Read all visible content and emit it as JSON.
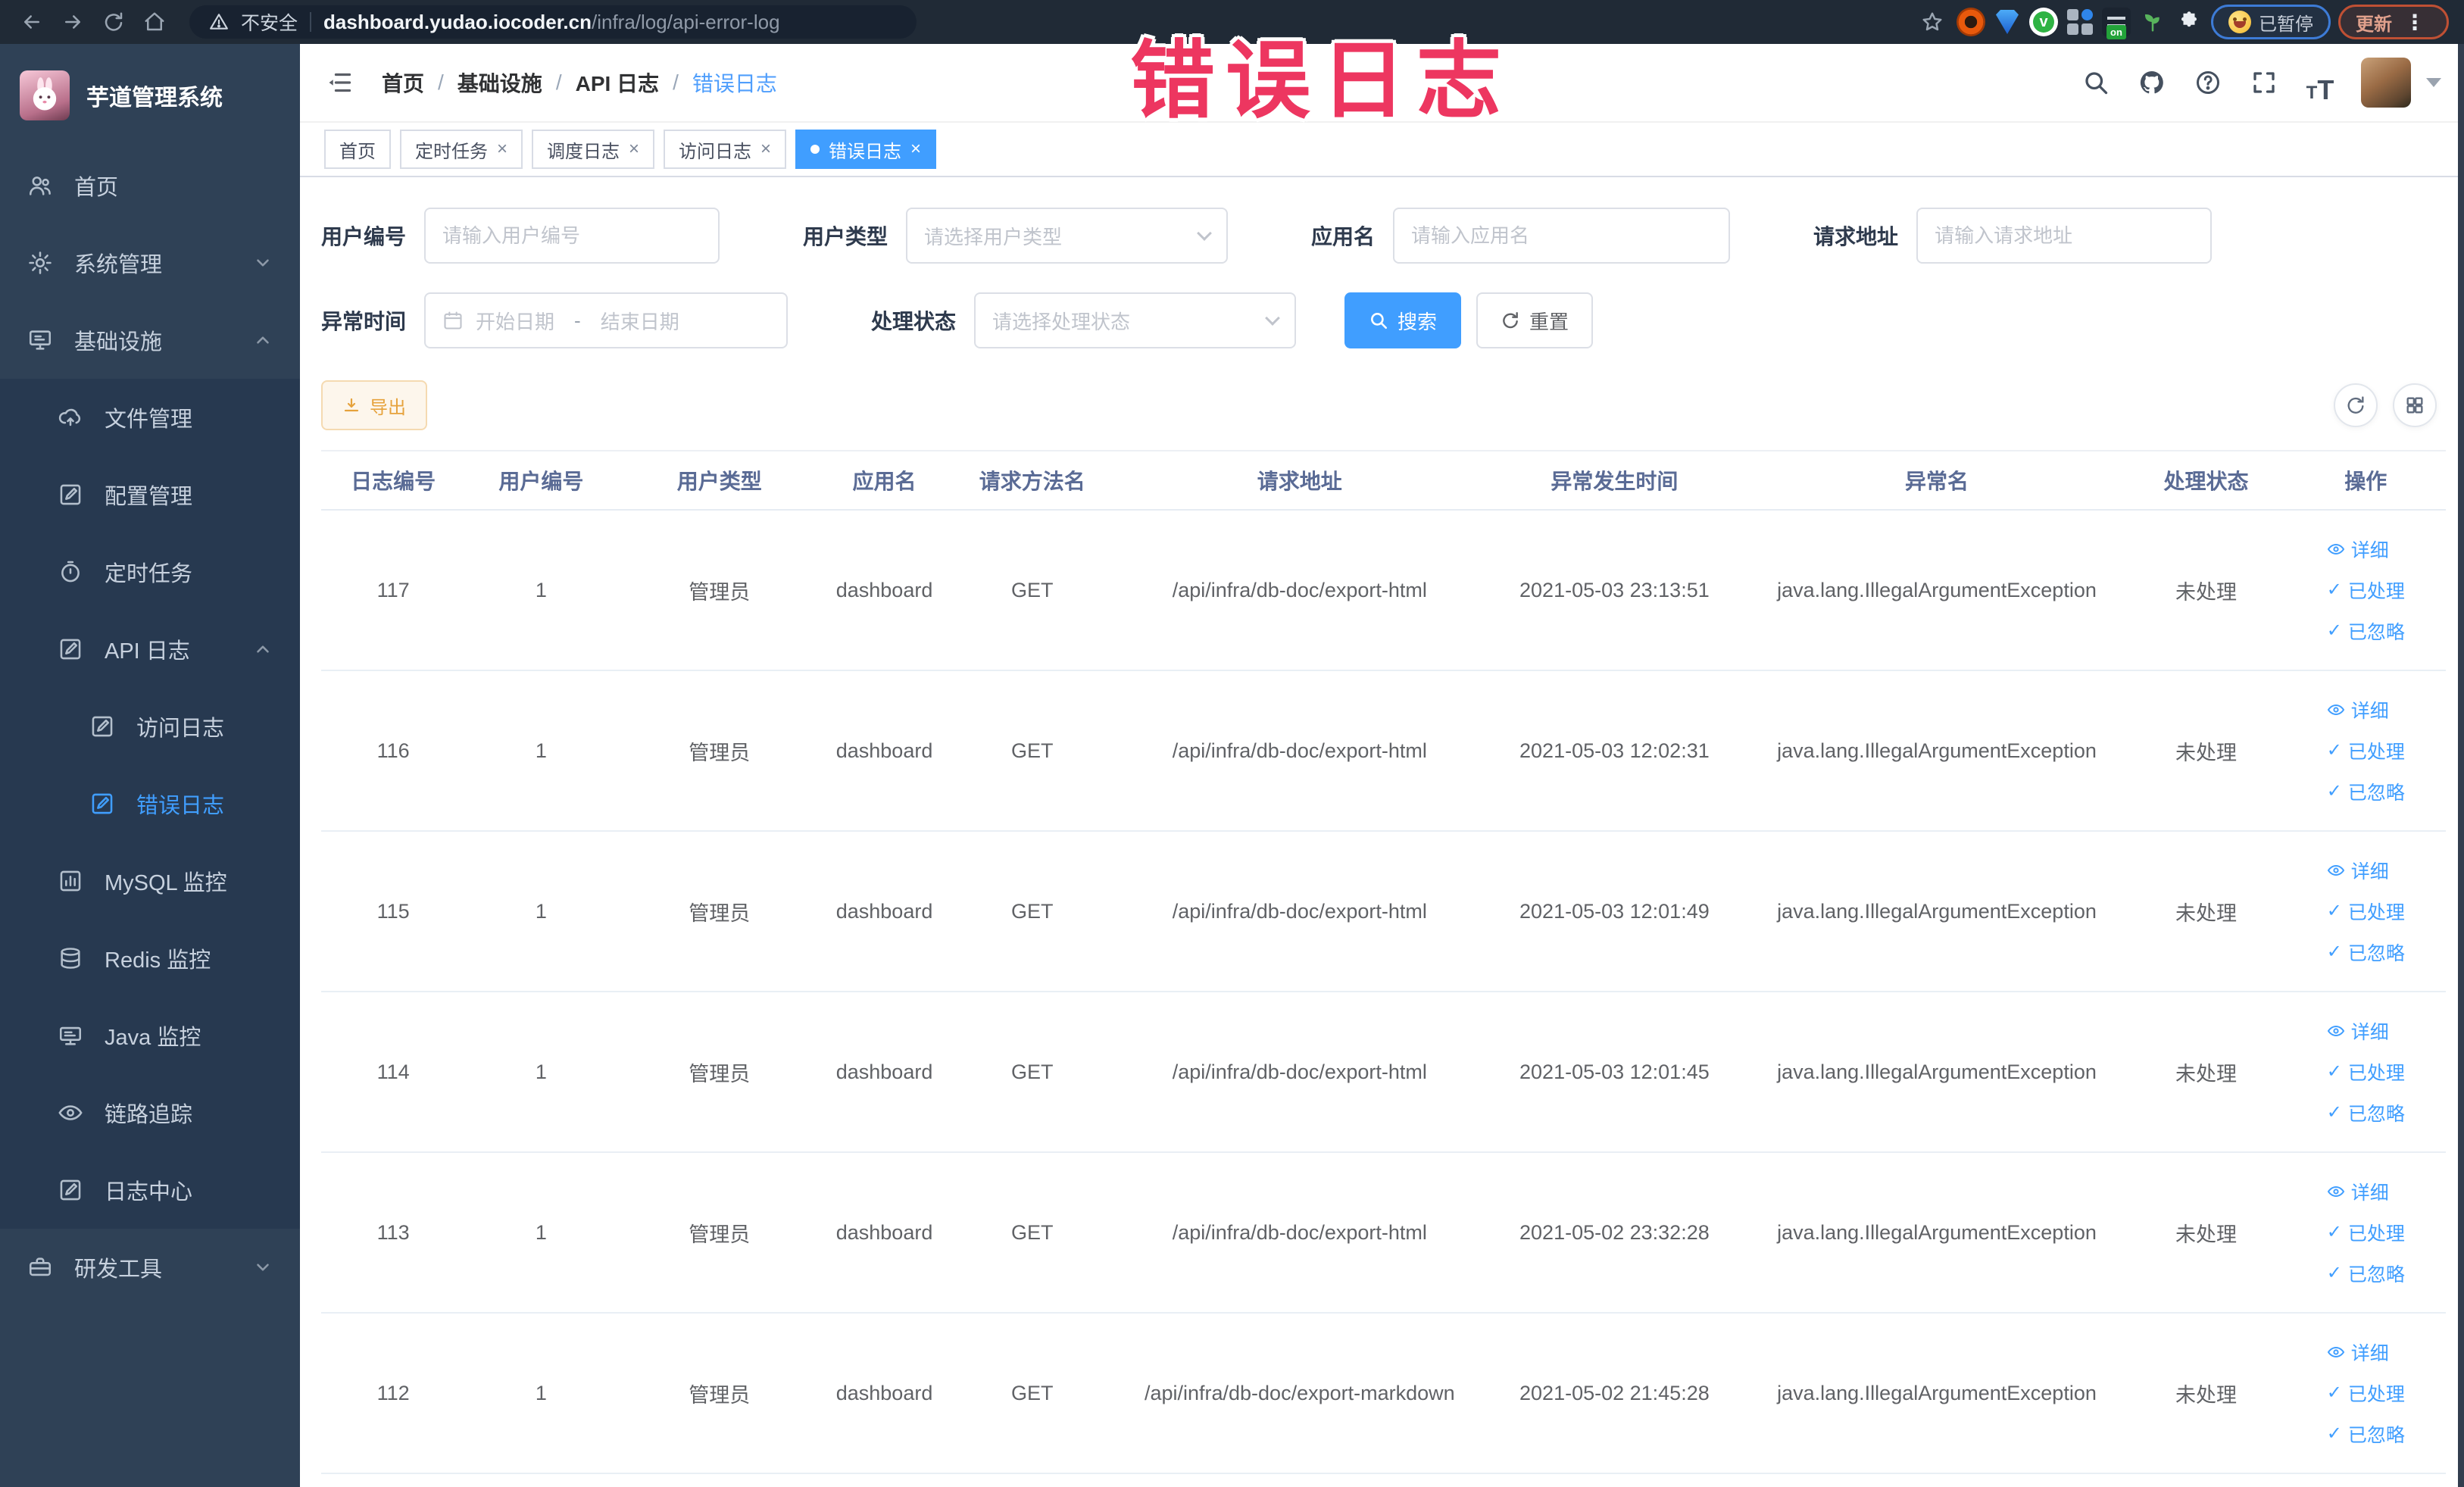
{
  "colors": {
    "primary": "#409eff",
    "warning": "#e6a23c",
    "overlay_pink": "#ed3660",
    "sidebar_bg": "#2f4156",
    "submenu_bg": "#273950",
    "browser_bar": "#202a36",
    "active_link": "#409eff"
  },
  "browser": {
    "security_label": "不安全",
    "url_domain": "dashboard.yudao.iocoder.cn",
    "url_path": "/infra/log/api-error-log",
    "paused_label": "已暂停",
    "update_label": "更新",
    "menu_dots": "⋮"
  },
  "overlay": {
    "title": "错误日志"
  },
  "sidebar": {
    "logo_title": "芋道管理系统",
    "items": [
      {
        "label": "首页"
      },
      {
        "label": "系统管理"
      },
      {
        "label": "基础设施"
      },
      {
        "label": "文件管理"
      },
      {
        "label": "配置管理"
      },
      {
        "label": "定时任务"
      },
      {
        "label": "API 日志"
      },
      {
        "label": "访问日志"
      },
      {
        "label": "错误日志"
      },
      {
        "label": "MySQL 监控"
      },
      {
        "label": "Redis 监控"
      },
      {
        "label": "Java 监控"
      },
      {
        "label": "链路追踪"
      },
      {
        "label": "日志中心"
      },
      {
        "label": "研发工具"
      }
    ]
  },
  "breadcrumb": {
    "items": [
      "首页",
      "基础设施",
      "API 日志",
      "错误日志"
    ],
    "separator": "/"
  },
  "tabs": [
    {
      "label": "首页"
    },
    {
      "label": "定时任务"
    },
    {
      "label": "调度日志"
    },
    {
      "label": "访问日志"
    },
    {
      "label": "错误日志"
    }
  ],
  "filters": {
    "user_id": {
      "label": "用户编号",
      "placeholder": "请输入用户编号"
    },
    "user_type": {
      "label": "用户类型",
      "placeholder": "请选择用户类型"
    },
    "app_name": {
      "label": "应用名",
      "placeholder": "请输入应用名"
    },
    "request_url": {
      "label": "请求地址",
      "placeholder": "请输入请求地址"
    },
    "exception_time": {
      "label": "异常时间",
      "start_placeholder": "开始日期",
      "separator": "-",
      "end_placeholder": "结束日期"
    },
    "process_status": {
      "label": "处理状态",
      "placeholder": "请选择处理状态"
    },
    "search_label": "搜索",
    "reset_label": "重置"
  },
  "toolbar": {
    "export_label": "导出"
  },
  "table": {
    "headers": [
      "日志编号",
      "用户编号",
      "用户类型",
      "应用名",
      "请求方法名",
      "请求地址",
      "异常发生时间",
      "异常名",
      "处理状态",
      "操作"
    ],
    "actions": {
      "detail": "详细",
      "processed": "已处理",
      "ignored": "已忽略"
    },
    "rows": [
      {
        "id": "117",
        "user_id": "1",
        "user_type": "管理员",
        "app": "dashboard",
        "method": "GET",
        "url": "/api/infra/db-doc/export-html",
        "time": "2021-05-03 23:13:51",
        "exception": "java.lang.IllegalArgumentException",
        "status": "未处理"
      },
      {
        "id": "116",
        "user_id": "1",
        "user_type": "管理员",
        "app": "dashboard",
        "method": "GET",
        "url": "/api/infra/db-doc/export-html",
        "time": "2021-05-03 12:02:31",
        "exception": "java.lang.IllegalArgumentException",
        "status": "未处理"
      },
      {
        "id": "115",
        "user_id": "1",
        "user_type": "管理员",
        "app": "dashboard",
        "method": "GET",
        "url": "/api/infra/db-doc/export-html",
        "time": "2021-05-03 12:01:49",
        "exception": "java.lang.IllegalArgumentException",
        "status": "未处理"
      },
      {
        "id": "114",
        "user_id": "1",
        "user_type": "管理员",
        "app": "dashboard",
        "method": "GET",
        "url": "/api/infra/db-doc/export-html",
        "time": "2021-05-03 12:01:45",
        "exception": "java.lang.IllegalArgumentException",
        "status": "未处理"
      },
      {
        "id": "113",
        "user_id": "1",
        "user_type": "管理员",
        "app": "dashboard",
        "method": "GET",
        "url": "/api/infra/db-doc/export-html",
        "time": "2021-05-02 23:32:28",
        "exception": "java.lang.IllegalArgumentException",
        "status": "未处理"
      },
      {
        "id": "112",
        "user_id": "1",
        "user_type": "管理员",
        "app": "dashboard",
        "method": "GET",
        "url": "/api/infra/db-doc/export-markdown",
        "time": "2021-05-02 21:45:28",
        "exception": "java.lang.IllegalArgumentException",
        "status": "未处理"
      }
    ]
  }
}
